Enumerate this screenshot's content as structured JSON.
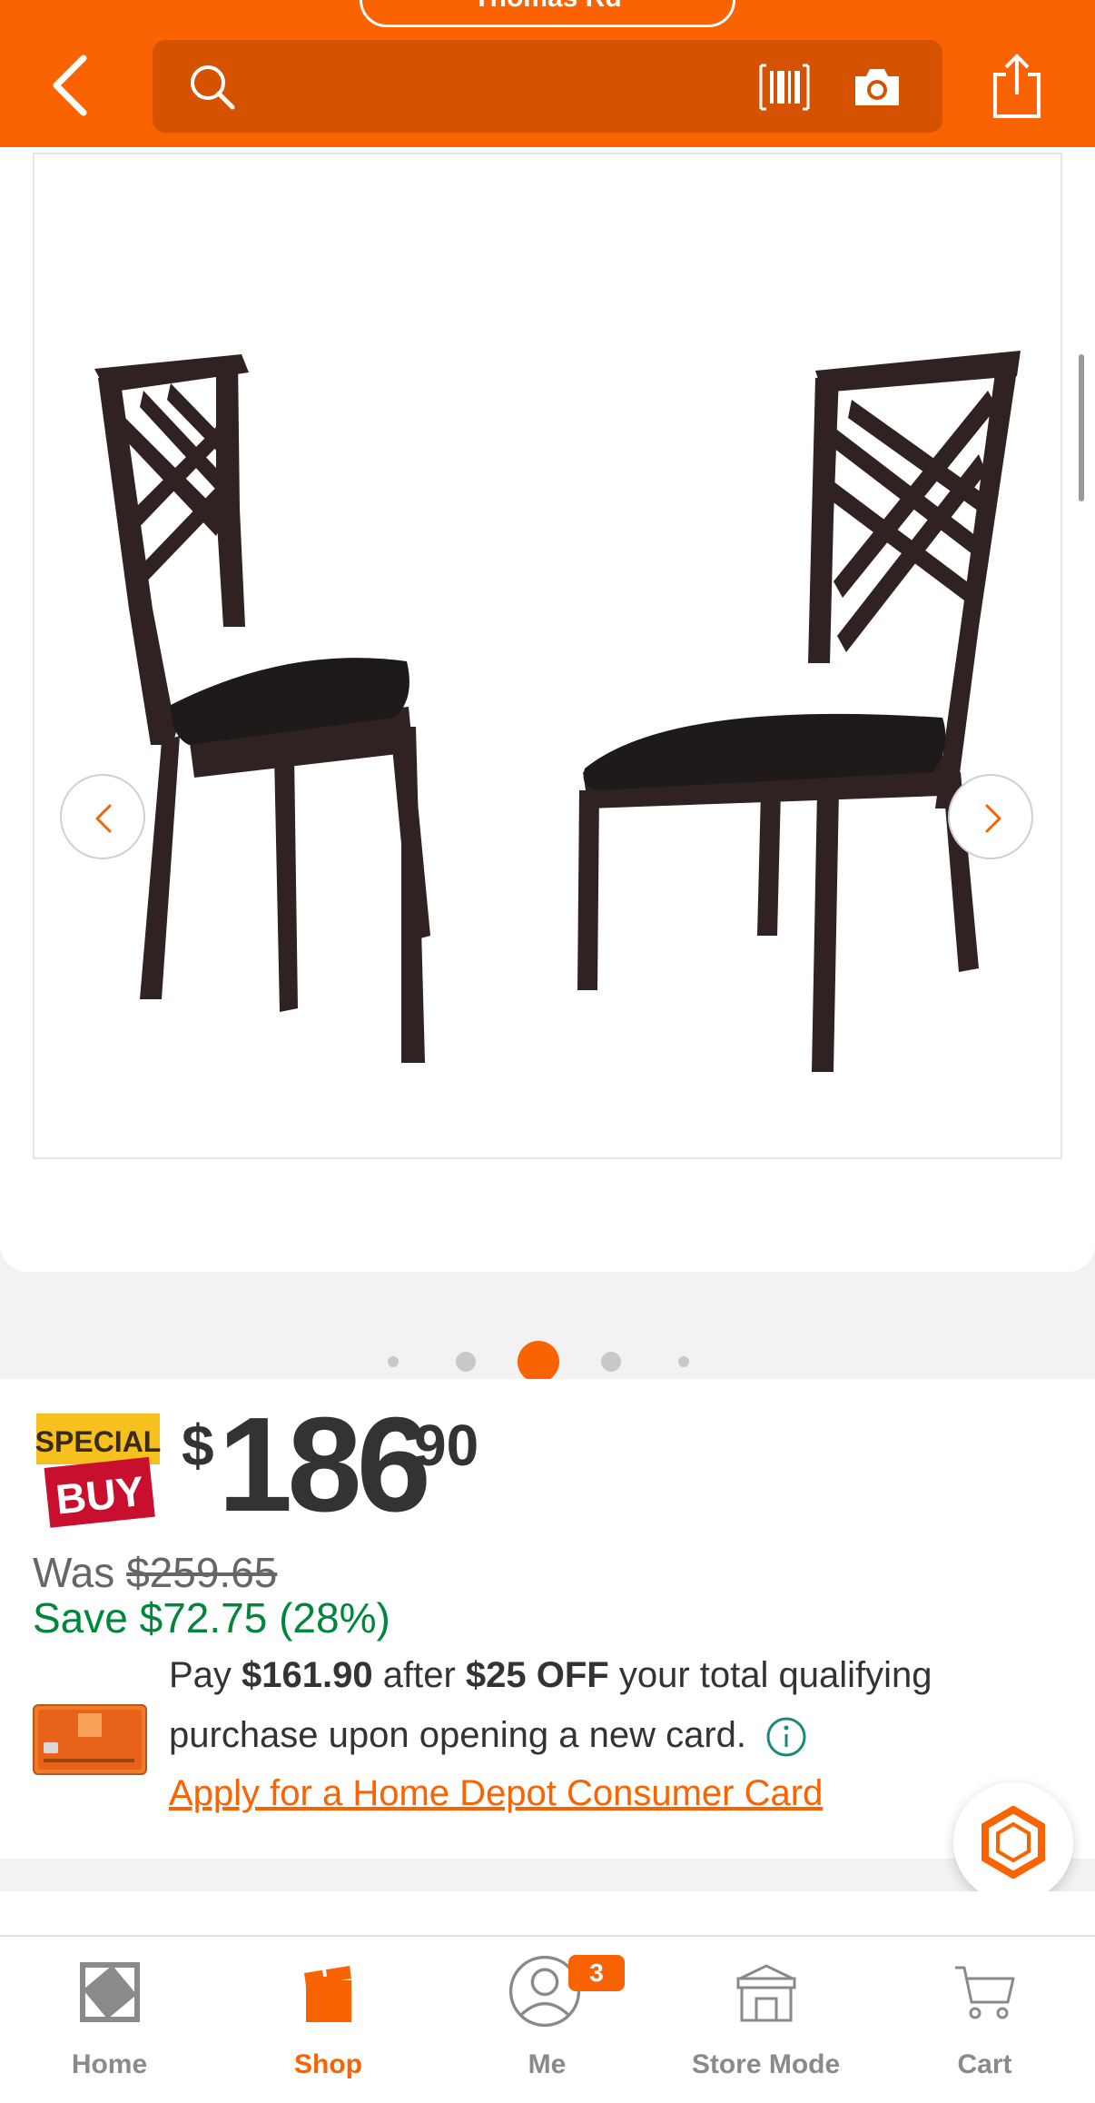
{
  "header": {
    "store_label": "Thomas Rd",
    "search_placeholder": "",
    "icons": [
      "back-icon",
      "search-icon",
      "barcode-icon",
      "camera-icon",
      "share-icon"
    ],
    "accent_color": "#f96302"
  },
  "gallery": {
    "image_alt": "Pair of espresso wood dining chairs with crisscross backs and dark faux leather seats",
    "dot_count": 5,
    "active_dot_index": 2
  },
  "price": {
    "badge_top": "SPECIAL",
    "badge_bottom": "BUY",
    "dollar_sign": "$",
    "dollars": "186",
    "cents": "90",
    "was_label": "Was",
    "was_price": "$259.65",
    "save_text": "Save $72.75 (28%)"
  },
  "promo": {
    "line1_pre": "Pay ",
    "line1_amount": "$161.90",
    "line1_mid": " after ",
    "line1_off": "$25 OFF",
    "line1_post": " your total qualifying",
    "line2": "purchase upon opening a new card.",
    "apply_link": "Apply for a Home Depot Consumer Card"
  },
  "nav": {
    "items": [
      {
        "label": "Home",
        "icon": "home-depot-logo-icon"
      },
      {
        "label": "Shop",
        "icon": "shop-icon"
      },
      {
        "label": "Me",
        "icon": "user-icon"
      },
      {
        "label": "Store Mode",
        "icon": "store-icon"
      },
      {
        "label": "Cart",
        "icon": "cart-icon"
      }
    ],
    "active": "Shop",
    "me_badge": "3"
  }
}
